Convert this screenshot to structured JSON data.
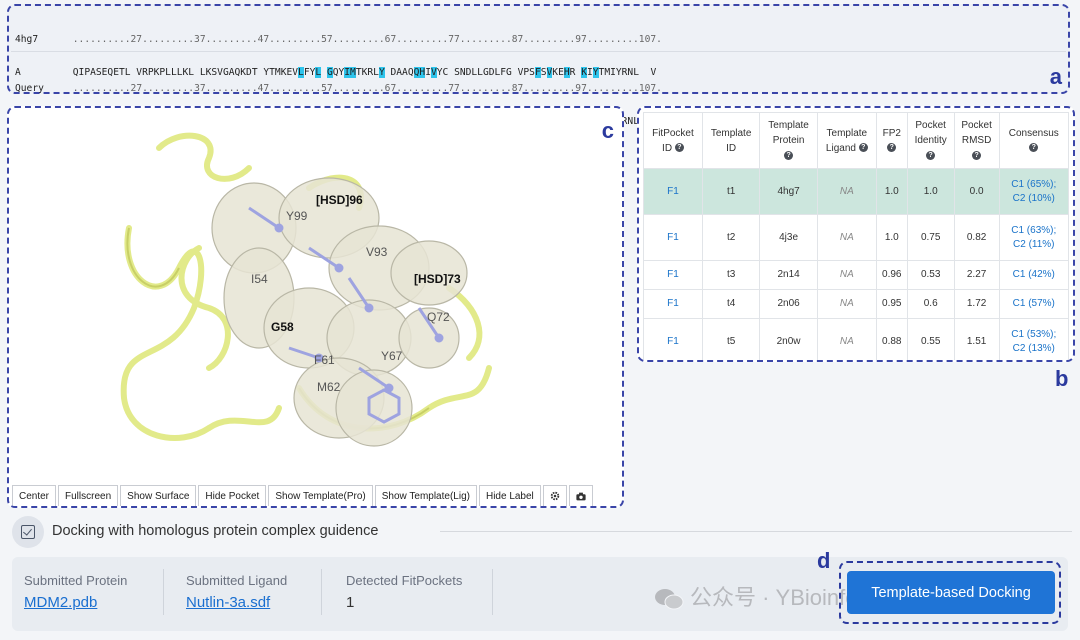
{
  "alignment": {
    "ruler": "..........27.........37.........47.........57.........67.........77.........87.........97.........107.",
    "blocks": [
      {
        "name": "4hg7",
        "chain": "A"
      },
      {
        "name": "Query",
        "chain": "A"
      }
    ],
    "sequence_segments": [
      {
        "t": "QIPASEQETL VRPKPLLLKL LKSVGAQKDT YTMKEV",
        "h": false
      },
      {
        "t": "L",
        "h": true
      },
      {
        "t": "FY",
        "h": false
      },
      {
        "t": "L",
        "h": true
      },
      {
        "t": " ",
        "h": false
      },
      {
        "t": "G",
        "h": true
      },
      {
        "t": "QY",
        "h": false
      },
      {
        "t": "IM",
        "h": true
      },
      {
        "t": "TKRL",
        "h": false
      },
      {
        "t": "Y",
        "h": true
      },
      {
        "t": " DAAQ",
        "h": false
      },
      {
        "t": "QH",
        "h": true
      },
      {
        "t": "I",
        "h": false
      },
      {
        "t": "V",
        "h": true
      },
      {
        "t": "YC SNDLLGDLFG VPS",
        "h": false
      },
      {
        "t": "F",
        "h": true
      },
      {
        "t": "S",
        "h": false
      },
      {
        "t": "V",
        "h": true
      },
      {
        "t": "KE",
        "h": false
      },
      {
        "t": "H",
        "h": true
      },
      {
        "t": "R ",
        "h": false
      },
      {
        "t": "K",
        "h": true
      },
      {
        "t": "I",
        "h": false
      },
      {
        "t": "Y",
        "h": true
      },
      {
        "t": "TMIYRNL  V",
        "h": false
      }
    ]
  },
  "labels": {
    "a": "a",
    "b": "b",
    "c": "c",
    "d": "d"
  },
  "viewer": {
    "residue_labels": [
      {
        "text": "[HSD]96",
        "bold": true
      },
      {
        "text": "Y99",
        "bold": false
      },
      {
        "text": "V93",
        "bold": false
      },
      {
        "text": "[HSD]73",
        "bold": true
      },
      {
        "text": "I54",
        "bold": false
      },
      {
        "text": "G58",
        "bold": true
      },
      {
        "text": "Q72",
        "bold": false
      },
      {
        "text": "Y67",
        "bold": false
      },
      {
        "text": "F61",
        "bold": false
      },
      {
        "text": "M62",
        "bold": false
      }
    ],
    "toolbar": [
      "Center",
      "Fullscreen",
      "Show Surface",
      "Hide Pocket",
      "Show Template(Pro)",
      "Show Template(Lig)",
      "Hide Label"
    ],
    "toolbar_icons": [
      "gear-icon",
      "camera-icon"
    ],
    "colors": {
      "ribbon": "#e2ea8a",
      "surface": "#e6e4d4",
      "atoms": "#9ea3e0"
    }
  },
  "table": {
    "headers": [
      {
        "lines": [
          "FitPocket",
          "ID"
        ],
        "help": true
      },
      {
        "lines": [
          "Template",
          "ID"
        ],
        "help": false
      },
      {
        "lines": [
          "Template",
          "Protein"
        ],
        "help": true
      },
      {
        "lines": [
          "Template",
          "Ligand"
        ],
        "help": true
      },
      {
        "lines": [
          "FP2"
        ],
        "help": true
      },
      {
        "lines": [
          "Pocket",
          "Identity"
        ],
        "help": true
      },
      {
        "lines": [
          "Pocket",
          "RMSD"
        ],
        "help": true
      },
      {
        "lines": [
          "Consensus"
        ],
        "help": true
      }
    ],
    "rows": [
      {
        "pocket": "F1",
        "tid": "t1",
        "protein": "4hg7",
        "ligand": "NA",
        "fp2": "1.0",
        "identity": "1.0",
        "rmsd": "0.0",
        "consensus": [
          "C1 (65%);",
          "C2 (10%)"
        ],
        "selected": true
      },
      {
        "pocket": "F1",
        "tid": "t2",
        "protein": "4j3e",
        "ligand": "NA",
        "fp2": "1.0",
        "identity": "0.75",
        "rmsd": "0.82",
        "consensus": [
          "C1 (63%);",
          "C2 (11%)"
        ],
        "selected": false
      },
      {
        "pocket": "F1",
        "tid": "t3",
        "protein": "2n14",
        "ligand": "NA",
        "fp2": "0.96",
        "identity": "0.53",
        "rmsd": "2.27",
        "consensus": [
          "C1 (42%)"
        ],
        "selected": false
      },
      {
        "pocket": "F1",
        "tid": "t4",
        "protein": "2n06",
        "ligand": "NA",
        "fp2": "0.95",
        "identity": "0.6",
        "rmsd": "1.72",
        "consensus": [
          "C1 (57%)"
        ],
        "selected": false
      },
      {
        "pocket": "F1",
        "tid": "t5",
        "protein": "2n0w",
        "ligand": "NA",
        "fp2": "0.88",
        "identity": "0.55",
        "rmsd": "1.51",
        "consensus": [
          "C1 (53%);",
          "C2 (13%)"
        ],
        "selected": false
      }
    ]
  },
  "section": {
    "title": "Docking with homologus protein complex guidence"
  },
  "info": {
    "protein_label": "Submitted Protein",
    "protein_value": "MDM2.pdb",
    "ligand_label": "Submitted Ligand",
    "ligand_value": "Nutlin-3a.sdf",
    "pockets_label": "Detected FitPockets",
    "pockets_value": "1"
  },
  "dock_button": "Template-based Docking",
  "watermark": "公众号 · YBioinformatics",
  "colors": {
    "accent": "#1f74d6",
    "frame": "#3a45a8",
    "highlight": "#2ec4ec",
    "selected_row": "#cce6dd"
  }
}
